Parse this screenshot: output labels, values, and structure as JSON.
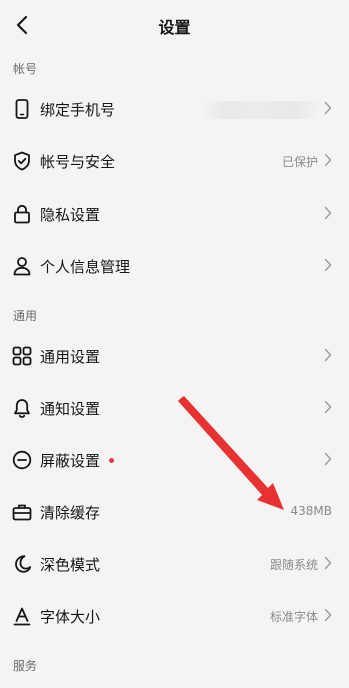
{
  "header": {
    "title": "设置"
  },
  "sections": {
    "account": "帐号",
    "general": "通用",
    "services": "服务"
  },
  "rows": {
    "phone": {
      "label": "绑定手机号"
    },
    "security": {
      "label": "帐号与安全",
      "value": "已保护"
    },
    "privacy": {
      "label": "隐私设置"
    },
    "personal_info": {
      "label": "个人信息管理"
    },
    "general_settings": {
      "label": "通用设置"
    },
    "notifications": {
      "label": "通知设置"
    },
    "block": {
      "label": "屏蔽设置"
    },
    "cache": {
      "label": "清除缓存",
      "value": "438MB"
    },
    "dark_mode": {
      "label": "深色模式",
      "value": "跟随系统"
    },
    "font_size": {
      "label": "字体大小",
      "value": "标准字体"
    }
  },
  "colors": {
    "background": "#f4f4f4",
    "text": "#161616",
    "secondary_text": "#8a8a8a",
    "notification_dot": "#e8354a",
    "annotation_arrow": "#e83232"
  },
  "icons": {
    "back": "chevron-left-icon",
    "phone": "smartphone-icon",
    "security": "shield-check-icon",
    "privacy": "lock-icon",
    "personal_info": "user-icon",
    "general_settings": "grid-icon",
    "notifications": "bell-icon",
    "block": "minus-circle-icon",
    "cache": "toolbox-icon",
    "dark_mode": "moon-icon",
    "font_size": "font-a-icon",
    "chevron": "chevron-right-icon"
  }
}
